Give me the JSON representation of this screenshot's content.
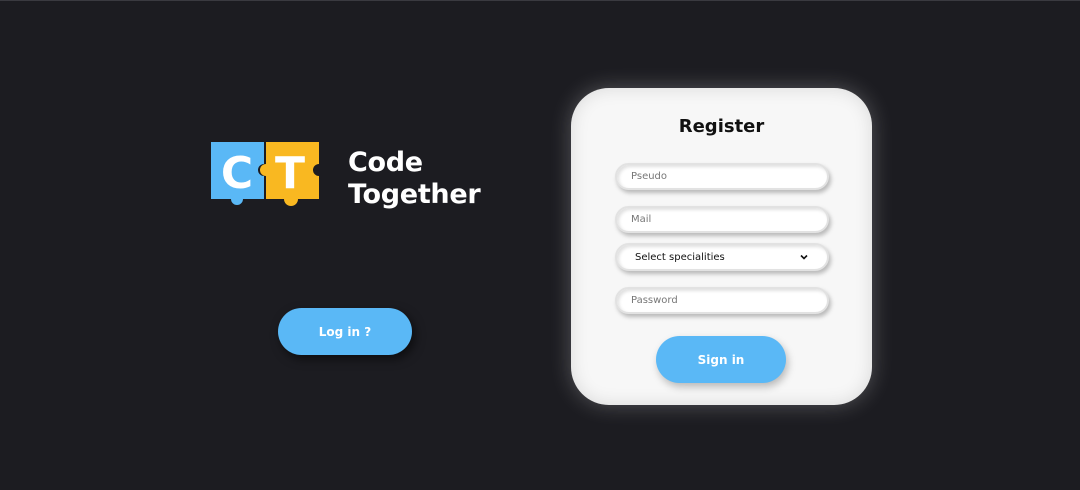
{
  "brand": {
    "logo_letters": [
      "C",
      "T"
    ],
    "name_line1": "Code",
    "name_line2": "Together",
    "logo_colors": {
      "left": "#5ab8f6",
      "right": "#f9b821"
    }
  },
  "login": {
    "label": "Log in ?"
  },
  "register": {
    "title": "Register",
    "pseudo_placeholder": "Pseudo",
    "mail_placeholder": "Mail",
    "specialities_selected": "Select specialities",
    "password_placeholder": "Password",
    "submit_label": "Sign in"
  },
  "colors": {
    "background": "#1c1c21",
    "accent": "#5ab8f6",
    "card": "#f7f7f7"
  },
  "icons": {
    "select": "chevron-down-icon"
  }
}
